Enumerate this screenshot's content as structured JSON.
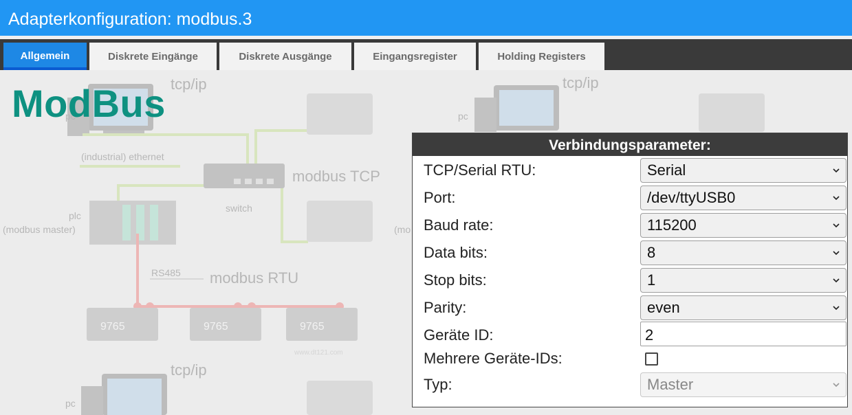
{
  "window": {
    "title": "Adapterkonfiguration: modbus.3"
  },
  "tabs": [
    {
      "label": "Allgemein",
      "active": true
    },
    {
      "label": "Diskrete Eingänge"
    },
    {
      "label": "Diskrete Ausgänge"
    },
    {
      "label": "Eingangsregister"
    },
    {
      "label": "Holding Registers"
    }
  ],
  "brand": {
    "text": "ModBus",
    "color": "#0e9181"
  },
  "diagram": {
    "tcpip": "tcp/ip",
    "pc": "pc",
    "ethernet": "(industrial) ethernet",
    "modbus_tcp": "modbus TCP",
    "switch": "switch",
    "plc": "plc",
    "plc_master": "(modbus master)",
    "plc_master_partial": "(mo",
    "rs485": "RS485",
    "modbus_rtu": "modbus RTU",
    "display_value": "9765",
    "watermark": "www.dt121.com"
  },
  "panel": {
    "title": "Verbindungsparameter:",
    "fields": [
      {
        "label": "TCP/Serial RTU:",
        "value": "Serial"
      },
      {
        "label": "Port:",
        "value": "/dev/ttyUSB0"
      },
      {
        "label": "Baud rate:",
        "value": "115200"
      },
      {
        "label": "Data bits:",
        "value": "8"
      },
      {
        "label": "Stop bits:",
        "value": "1"
      },
      {
        "label": "Parity:",
        "value": "even"
      }
    ],
    "device_id": {
      "label": "Geräte ID:",
      "value": "2"
    },
    "multi_ids": {
      "label": "Mehrere Geräte-IDs:",
      "checked": false
    },
    "type": {
      "label": "Typ:",
      "value": "Master"
    }
  },
  "colors": {
    "titlebar": "#2196f3",
    "tab_active": "#1e88e5",
    "ethernet_line": "#b5d96a",
    "rs485_line": "#ef5350"
  }
}
